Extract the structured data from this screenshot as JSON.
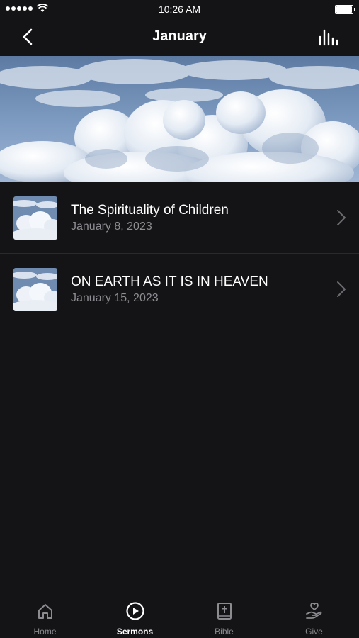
{
  "status_bar": {
    "time": "10:26 AM"
  },
  "nav": {
    "title": "January",
    "back_icon": "chevron-left-icon",
    "action_icon": "equalizer-icon"
  },
  "sermons": [
    {
      "title": "The Spirituality of Children",
      "date": "January 8, 2023"
    },
    {
      "title": "ON EARTH AS IT IS IN HEAVEN",
      "date": "January 15, 2023"
    }
  ],
  "tabs": [
    {
      "label": "Home",
      "icon": "home-icon",
      "active": false
    },
    {
      "label": "Sermons",
      "icon": "play-circle-icon",
      "active": true
    },
    {
      "label": "Bible",
      "icon": "bible-icon",
      "active": false
    },
    {
      "label": "Give",
      "icon": "give-hand-heart-icon",
      "active": false
    }
  ],
  "colors": {
    "background": "#141416",
    "secondary_text": "#8d8d92",
    "sky": "#6f8bb0"
  }
}
